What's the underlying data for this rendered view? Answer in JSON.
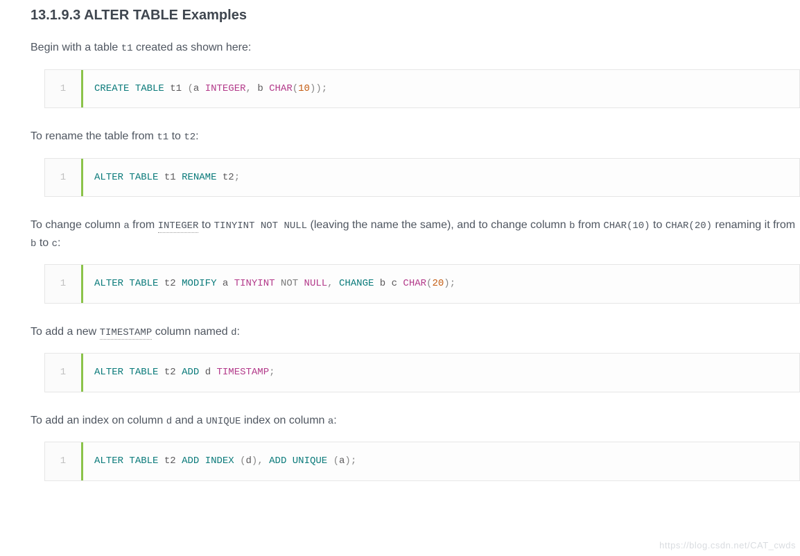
{
  "heading": "13.1.9.3 ALTER TABLE Examples",
  "para1": {
    "t1": "Begin with a table ",
    "code1": "t1",
    "t2": " created as shown here:"
  },
  "code1": {
    "lineno": "1",
    "kw_create": "CREATE",
    "kw_table": "TABLE",
    "id_t1": "t1",
    "punc_l": "(",
    "id_a": "a",
    "ty_int": "INTEGER",
    "comma": ",",
    "id_b": "b",
    "ty_char": "CHAR",
    "num10": "10",
    "punc_r": ")",
    "semi": ";"
  },
  "para2": {
    "t1": "To rename the table from ",
    "code1": "t1",
    "t2": " to ",
    "code2": "t2",
    "t3": ":"
  },
  "code2": {
    "lineno": "1",
    "kw_alter": "ALTER",
    "kw_table": "TABLE",
    "id_t1": "t1",
    "kw_rename": "RENAME",
    "id_t2": "t2",
    "semi": ";"
  },
  "para3": {
    "t1": "To change column ",
    "code_a": "a",
    "t2": " from ",
    "code_int": "INTEGER",
    "t3": " to ",
    "code_tiny": "TINYINT NOT NULL",
    "t4": " (leaving the name the same), and to change column ",
    "code_b": "b",
    "t5": " from ",
    "code_char10": "CHAR(10)",
    "t6": " to ",
    "code_char20": "CHAR(20)",
    "t7": " renaming it from ",
    "code_b2": "b",
    "t8": " to ",
    "code_c": "c",
    "t9": ":"
  },
  "code3": {
    "lineno": "1",
    "kw_alter": "ALTER",
    "kw_table": "TABLE",
    "id_t2": "t2",
    "kw_modify": "MODIFY",
    "id_a": "a",
    "ty_tiny": "TINYINT",
    "kw_not": "NOT",
    "ty_null": "NULL",
    "comma": ",",
    "kw_change": "CHANGE",
    "id_b": "b",
    "id_c": "c",
    "ty_char": "CHAR",
    "num20": "20",
    "semi": ";"
  },
  "para4": {
    "t1": "To add a new ",
    "code_ts": "TIMESTAMP",
    "t2": " column named ",
    "code_d": "d",
    "t3": ":"
  },
  "code4": {
    "lineno": "1",
    "kw_alter": "ALTER",
    "kw_table": "TABLE",
    "id_t2": "t2",
    "kw_add": "ADD",
    "id_d": "d",
    "ty_ts": "TIMESTAMP",
    "semi": ";"
  },
  "para5": {
    "t1": "To add an index on column ",
    "code_d": "d",
    "t2": " and a ",
    "code_uq": "UNIQUE",
    "t3": " index on column ",
    "code_a": "a",
    "t4": ":"
  },
  "code5": {
    "lineno": "1",
    "kw_alter": "ALTER",
    "kw_table": "TABLE",
    "id_t2": "t2",
    "kw_add": "ADD",
    "kw_index": "INDEX",
    "id_d": "d",
    "comma": ",",
    "kw_add2": "ADD",
    "kw_unique": "UNIQUE",
    "id_a": "a",
    "semi": ";"
  },
  "watermark": "https://blog.csdn.net/CAT_cwds"
}
